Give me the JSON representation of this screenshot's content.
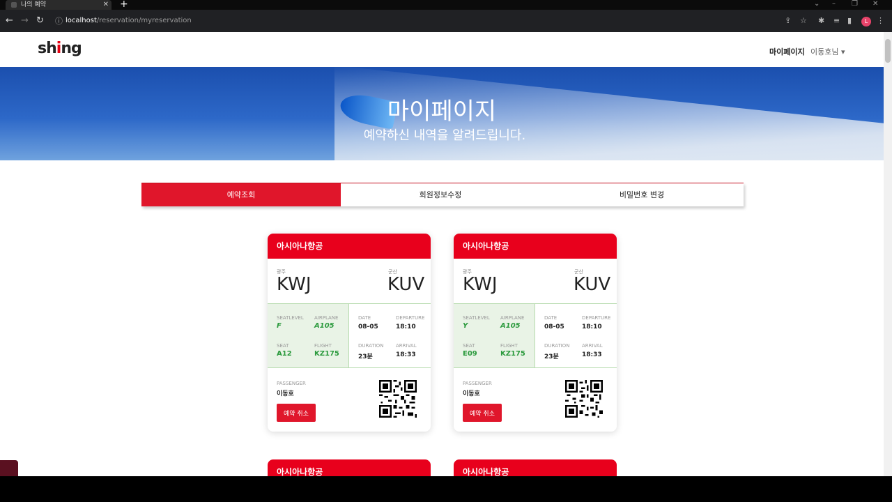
{
  "browser": {
    "tab_title": "나의 예약",
    "tab_close": "✕",
    "new_tab": "+",
    "url_host": "localhost",
    "url_path": "/reservation/myreservation",
    "profile_initial": "L"
  },
  "header": {
    "logo_left": "sh",
    "logo_accent": "i",
    "logo_right": "ng",
    "mypage_link": "마이페이지",
    "user_menu": "이동호님 ▾"
  },
  "hero": {
    "title": "마이페이지",
    "subtitle": "예약하신 내역을 알려드립니다."
  },
  "tabs": [
    {
      "label": "예약조회",
      "active": true
    },
    {
      "label": "회원정보수정",
      "active": false
    },
    {
      "label": "비밀번호 변경",
      "active": false
    }
  ],
  "labels": {
    "seatlevel": "SEATLEVEL",
    "airplane": "AIRPLANE",
    "seat": "SEAT",
    "flight": "FLIGHT",
    "date": "DATE",
    "departure": "DEPARTURE",
    "duration": "DURATION",
    "arrival": "ARRIVAL",
    "passenger": "PASSENGER",
    "cancel": "예약 취소"
  },
  "tickets": [
    {
      "airline": "아시아나항공",
      "from_city": "광주",
      "from_code": "KWJ",
      "to_city": "군산",
      "to_code": "KUV",
      "seatlevel": "F",
      "airplane": "A105",
      "seat": "A12",
      "flight": "KZ175",
      "date": "08-05",
      "departure": "18:10",
      "duration": "23분",
      "arrival": "18:33",
      "passenger": "이동호"
    },
    {
      "airline": "아시아나항공",
      "from_city": "광주",
      "from_code": "KWJ",
      "to_city": "군산",
      "to_code": "KUV",
      "seatlevel": "Y",
      "airplane": "A105",
      "seat": "E09",
      "flight": "KZ175",
      "date": "08-05",
      "departure": "18:10",
      "duration": "23분",
      "arrival": "18:33",
      "passenger": "이동호"
    }
  ],
  "next_tickets": [
    {
      "airline": "아시아나항공"
    },
    {
      "airline": "아시아나항공"
    }
  ],
  "colors": {
    "brand_red": "#e8001c",
    "green": "#2b9a3d"
  }
}
